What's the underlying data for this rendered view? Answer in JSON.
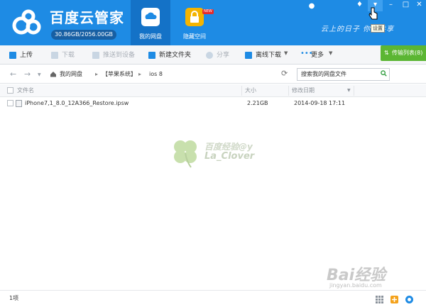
{
  "app": {
    "name": "百度云管家",
    "quota": "30.86GB/2056.00GB",
    "slogan": "云上的日子 你我共享"
  },
  "nav": {
    "tabs": [
      {
        "label": "我的网盘",
        "active": true
      },
      {
        "label": "隐藏空间",
        "badge": "NEW"
      }
    ]
  },
  "window": {
    "tooltip": "设置"
  },
  "toolbar": {
    "upload": "上传",
    "download": "下载",
    "push_device": "推送到设备",
    "new_folder": "新建文件夹",
    "share": "分享",
    "offline_download": "离线下载",
    "more": "更多",
    "transfer_list": "传输列表(8)"
  },
  "addressbar": {
    "crumbs": [
      "我的网盘",
      "【苹果系统】",
      "ios 8"
    ],
    "search_placeholder": "搜索我的网盘文件"
  },
  "table": {
    "headers": {
      "name": "文件名",
      "size": "大小",
      "modified": "修改日期"
    },
    "rows": [
      {
        "name": "iPhone7,1_8.0_12A366_Restore.ipsw",
        "size": "2.21GB",
        "modified": "2014-09-18 17:11"
      }
    ]
  },
  "watermark": {
    "line1": "百度经验@y",
    "line2": "La_Clover",
    "baidu": "Bai经验",
    "url": "jingyan.baidu.com"
  },
  "status": {
    "count": "1项"
  },
  "colors": {
    "brand_blue": "#1e8be4",
    "transfer_green": "#5bb633",
    "hidden_space_gold": "#f4b400"
  }
}
